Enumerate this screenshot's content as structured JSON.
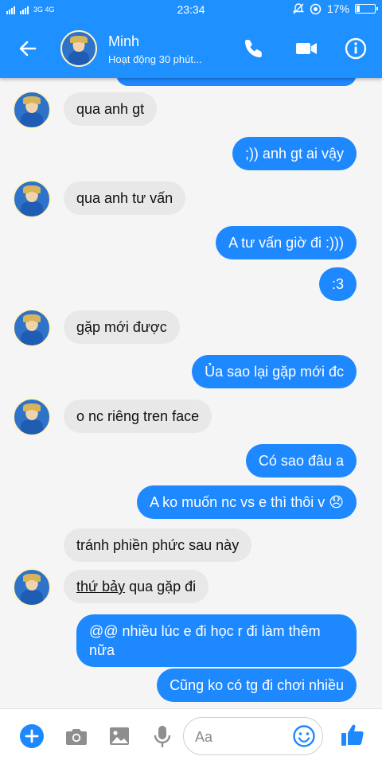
{
  "status_bar": {
    "left": "3G 4G",
    "time": "23:34",
    "battery": "17%",
    "battery_level": 0.17
  },
  "header": {
    "name": "Minh",
    "status": "Hoạt động 30 phút..."
  },
  "icons": {
    "back": "arrow-left-icon",
    "call": "phone-icon",
    "video": "video-camera-icon",
    "info": "info-icon",
    "add": "plus-icon",
    "camera": "camera-icon",
    "image": "image-icon",
    "mic": "microphone-icon",
    "emoji": "smiley-icon",
    "like": "thumbs-up-icon"
  },
  "colors": {
    "accent": "#1e90ff",
    "outgoing": "#1e88ff",
    "incoming": "#e8e8e8"
  },
  "messages": [
    {
      "from": "them",
      "text": "qua anh gt"
    },
    {
      "from": "me",
      "text": ";)) anh gt ai vậy"
    },
    {
      "from": "them",
      "text": "qua anh tư vấn"
    },
    {
      "from": "me",
      "text": "A tư vấn giờ đi :)))"
    },
    {
      "from": "me",
      "text": ":3"
    },
    {
      "from": "them",
      "text": "gặp mới được"
    },
    {
      "from": "me",
      "text": "Ủa sao lại gặp mới đc"
    },
    {
      "from": "them",
      "text": "o nc riêng tren face"
    },
    {
      "from": "me",
      "text": "Có sao đâu a"
    },
    {
      "from": "me",
      "text": "A ko muốn nc vs e thì thôi v 😞"
    },
    {
      "from": "them",
      "text": "tránh phiền phức sau này"
    },
    {
      "from": "them",
      "text_underlined": "thứ bảy",
      "text": " qua gặp đi"
    },
    {
      "from": "me",
      "text": "@@ nhiều lúc e đi học r đi làm thêm nữa"
    },
    {
      "from": "me",
      "text": "Cũng ko có tg đi chơi nhiều"
    }
  ],
  "composer": {
    "placeholder": "Aa"
  }
}
